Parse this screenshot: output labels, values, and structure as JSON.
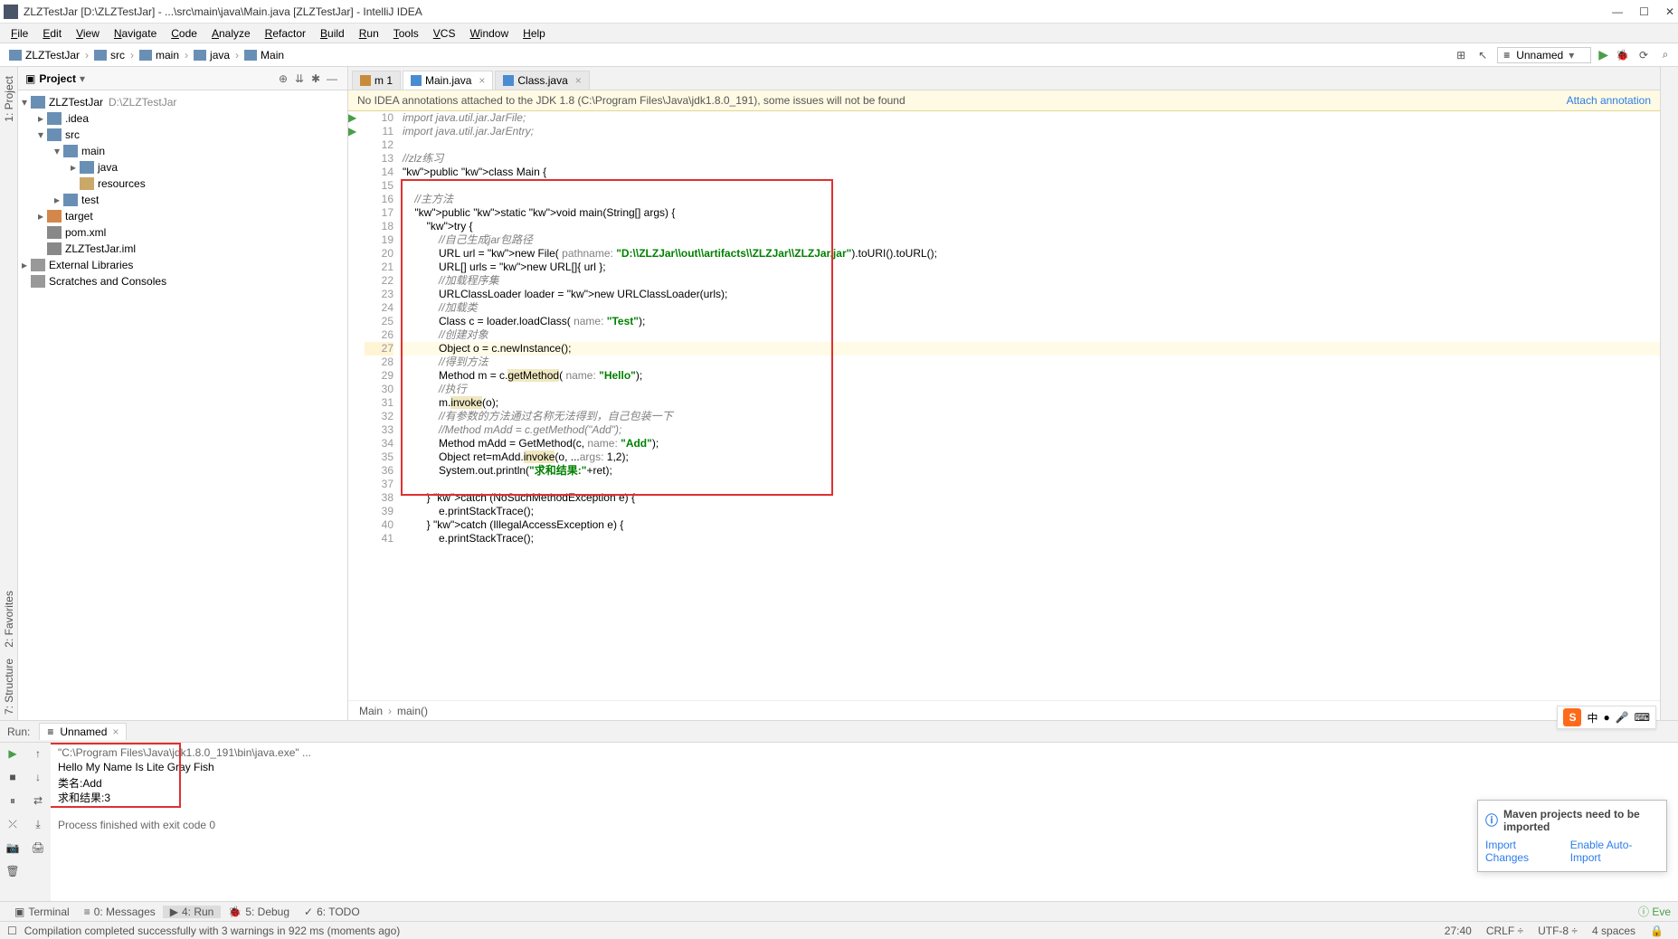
{
  "window": {
    "title": "ZLZTestJar [D:\\ZLZTestJar] - ...\\src\\main\\java\\Main.java [ZLZTestJar] - IntelliJ IDEA"
  },
  "menu": [
    "File",
    "Edit",
    "View",
    "Navigate",
    "Code",
    "Analyze",
    "Refactor",
    "Build",
    "Run",
    "Tools",
    "VCS",
    "Window",
    "Help"
  ],
  "breadcrumbs": [
    "ZLZTestJar",
    "src",
    "main",
    "java",
    "Main"
  ],
  "run_config": "Unnamed",
  "project": {
    "title": "Project",
    "root": {
      "name": "ZLZTestJar",
      "path": "D:\\ZLZTestJar"
    },
    "nodes": [
      {
        "name": ".idea",
        "depth": 1,
        "type": "folder-blue",
        "arrow": ">"
      },
      {
        "name": "src",
        "depth": 1,
        "type": "folder-blue",
        "arrow": "v"
      },
      {
        "name": "main",
        "depth": 2,
        "type": "folder-blue",
        "arrow": "v"
      },
      {
        "name": "java",
        "depth": 3,
        "type": "folder-blue",
        "arrow": ">"
      },
      {
        "name": "resources",
        "depth": 3,
        "type": "folder",
        "arrow": ""
      },
      {
        "name": "test",
        "depth": 2,
        "type": "folder-blue",
        "arrow": ">"
      },
      {
        "name": "target",
        "depth": 1,
        "type": "folder-orange",
        "arrow": ">"
      },
      {
        "name": "pom.xml",
        "depth": 1,
        "type": "file",
        "arrow": ""
      },
      {
        "name": "ZLZTestJar.iml",
        "depth": 1,
        "type": "file",
        "arrow": ""
      }
    ],
    "ext_libs": "External Libraries",
    "scratches": "Scratches and Consoles"
  },
  "editor": {
    "tabs": [
      {
        "label": "1",
        "kind": "mod",
        "active": false,
        "closable": false
      },
      {
        "label": "Main.java",
        "kind": "java",
        "active": true,
        "closable": true
      },
      {
        "label": "Class.java",
        "kind": "java",
        "active": false,
        "closable": true
      }
    ],
    "notification": "No IDEA annotations attached to the JDK 1.8 (C:\\Program Files\\Java\\jdk1.8.0_191), some issues will not be found",
    "notification_link": "Attach annotation",
    "crumb_class": "Main",
    "crumb_method": "main()"
  },
  "code": {
    "start": 10,
    "lines": [
      {
        "n": 10,
        "t": "import java.util.jar.JarFile;",
        "cls": "cmt"
      },
      {
        "n": 11,
        "t": "import java.util.jar.JarEntry;",
        "cls": "cmt"
      },
      {
        "n": 12,
        "t": ""
      },
      {
        "n": 13,
        "t": "//zlz练习",
        "cls": "cmt"
      },
      {
        "n": 14,
        "t": "public class Main {",
        "k": true,
        "play": true
      },
      {
        "n": 15,
        "t": ""
      },
      {
        "n": 16,
        "t": "    //主方法",
        "cls": "cmt"
      },
      {
        "n": 17,
        "t": "    public static void main(String[] args) {",
        "k": true,
        "play": true
      },
      {
        "n": 18,
        "t": "        try {",
        "k": true
      },
      {
        "n": 19,
        "t": "            //自己生成jar包路径",
        "cls": "cmt"
      },
      {
        "n": 20,
        "t": "            URL url = new File( pathname: \"D:\\\\ZLZJar\\\\out\\\\artifacts\\\\ZLZJar\\\\ZLZJar.jar\").toURI().toURL();"
      },
      {
        "n": 21,
        "t": "            URL[] urls = new URL[]{ url };"
      },
      {
        "n": 22,
        "t": "            //加载程序集",
        "cls": "cmt"
      },
      {
        "n": 23,
        "t": "            URLClassLoader loader = new URLClassLoader(urls);"
      },
      {
        "n": 24,
        "t": "            //加载类",
        "cls": "cmt"
      },
      {
        "n": 25,
        "t": "            Class c = loader.loadClass( name: \"Test\");"
      },
      {
        "n": 26,
        "t": "            //创建对象",
        "cls": "cmt"
      },
      {
        "n": 27,
        "t": "            Object o = c.newInstance();",
        "hl": true
      },
      {
        "n": 28,
        "t": "            //得到方法",
        "cls": "cmt"
      },
      {
        "n": 29,
        "t": "            Method m = c.getMethod( name: \"Hello\");"
      },
      {
        "n": 30,
        "t": "            //执行",
        "cls": "cmt"
      },
      {
        "n": 31,
        "t": "            m.invoke(o);"
      },
      {
        "n": 32,
        "t": "            //有参数的方法通过名称无法得到，自己包装一下",
        "cls": "cmt-cn"
      },
      {
        "n": 33,
        "t": "            //Method mAdd = c.getMethod(\"Add\");",
        "cls": "cmt"
      },
      {
        "n": 34,
        "t": "            Method mAdd = GetMethod(c, name: \"Add\");"
      },
      {
        "n": 35,
        "t": "            Object ret=mAdd.invoke(o, ...args: 1,2);"
      },
      {
        "n": 36,
        "t": "            System.out.println(\"求和结果:\"+ret);"
      },
      {
        "n": 37,
        "t": ""
      },
      {
        "n": 38,
        "t": "        } catch (NoSuchMethodException e) {",
        "k": true
      },
      {
        "n": 39,
        "t": "            e.printStackTrace();"
      },
      {
        "n": 40,
        "t": "        } catch (IllegalAccessException e) {",
        "k": true
      },
      {
        "n": 41,
        "t": "            e.printStackTrace();"
      }
    ]
  },
  "run": {
    "label": "Run:",
    "tab": "Unnamed",
    "lines": [
      {
        "t": "\"C:\\Program Files\\Java\\jdk1.8.0_191\\bin\\java.exe\" ...",
        "path": true
      },
      {
        "t": "Hello My Name Is Lite Gray Fish"
      },
      {
        "t": "类名:Add"
      },
      {
        "t": "求和结果:3"
      },
      {
        "t": ""
      },
      {
        "t": "Process finished with exit code 0",
        "exit": true
      }
    ]
  },
  "maven_popup": {
    "title": "Maven projects need to be imported",
    "link1": "Import Changes",
    "link2": "Enable Auto-Import"
  },
  "bottom_tabs": [
    {
      "ico": "▣",
      "label": "Terminal",
      "num": ""
    },
    {
      "ico": "≡",
      "label": "0: Messages",
      "num": ""
    },
    {
      "ico": "▶",
      "label": "4: Run",
      "num": "",
      "active": true
    },
    {
      "ico": "🐞",
      "label": "5: Debug",
      "num": ""
    },
    {
      "ico": "✓",
      "label": "6: TODO",
      "num": ""
    }
  ],
  "right_bottom_tab": "Eve",
  "status": {
    "msg": "Compilation completed successfully with 3 warnings in 922 ms (moments ago)",
    "pos": "27:40",
    "sep": "CRLF ÷",
    "enc": "UTF-8 ÷",
    "indent": "4 spaces"
  },
  "left_tabs": [
    "1: Project",
    "7: Structure"
  ],
  "fav_tab": "2: Favorites"
}
